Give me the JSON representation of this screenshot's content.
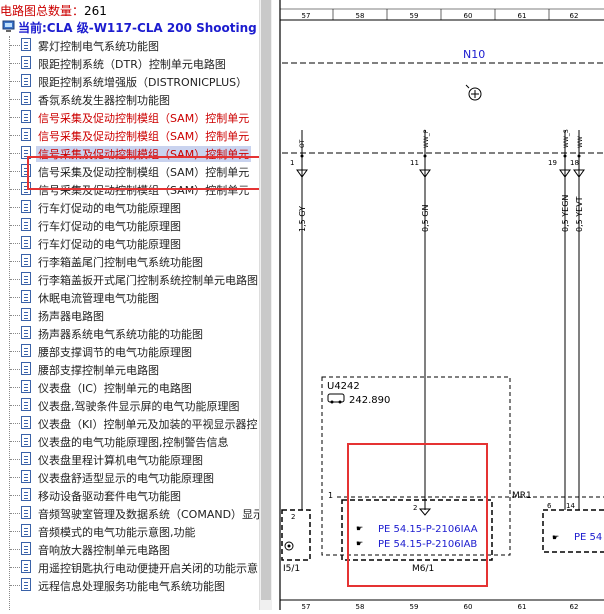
{
  "header": {
    "count_label": "电路图总数量：",
    "count_value": "261"
  },
  "tree": {
    "root_label": "当前:CLA 级-W117-CLA 200 Shooting B",
    "items": [
      {
        "label": "雾灯控制电气系统功能图",
        "style": "normal"
      },
      {
        "label": "限距控制系统（DTR）控制单元电路图",
        "style": "normal"
      },
      {
        "label": "限距控制系统增强版（DISTRONICPLUS）",
        "style": "normal"
      },
      {
        "label": "香氛系统发生器控制功能图",
        "style": "normal"
      },
      {
        "label": "信号采集及促动控制模组（SAM）控制单元",
        "style": "red"
      },
      {
        "label": "信号采集及促动控制模组（SAM）控制单元",
        "style": "red"
      },
      {
        "label": "信号采集及促动控制模组（SAM）控制单元",
        "style": "selected"
      },
      {
        "label": "信号采集及促动控制模组（SAM）控制单元",
        "style": "normal"
      },
      {
        "label": "信号采集及促动控制模组（SAM）控制单元",
        "style": "normal"
      },
      {
        "label": "行车灯促动的电气功能原理图",
        "style": "normal"
      },
      {
        "label": "行车灯促动的电气功能原理图",
        "style": "normal"
      },
      {
        "label": "行车灯促动的电气功能原理图",
        "style": "normal"
      },
      {
        "label": "行李箱盖尾门控制电气系统功能图",
        "style": "normal"
      },
      {
        "label": "行李箱盖扳开式尾门控制系统控制单元电路图",
        "style": "normal"
      },
      {
        "label": "休眠电流管理电气功能图",
        "style": "normal"
      },
      {
        "label": "扬声器电路图",
        "style": "normal"
      },
      {
        "label": "扬声器系统电气系统功能的功能图",
        "style": "normal"
      },
      {
        "label": "腰部支撑调节的电气功能原理图",
        "style": "normal"
      },
      {
        "label": "腰部支撑控制单元电路图",
        "style": "normal"
      },
      {
        "label": "仪表盘（IC）控制单元的电路图",
        "style": "normal"
      },
      {
        "label": "仪表盘,驾驶条件显示屏的电气功能原理图",
        "style": "normal"
      },
      {
        "label": "仪表盘（KI）控制单元及加装的平视显示器控",
        "style": "normal"
      },
      {
        "label": "仪表盘的电气功能原理图,控制警告信息",
        "style": "normal"
      },
      {
        "label": "仪表盘里程计算机电气功能原理图",
        "style": "normal"
      },
      {
        "label": "仪表盘舒适型显示的电气功能原理图",
        "style": "normal"
      },
      {
        "label": "移动设备驱动套件电气功能图",
        "style": "normal"
      },
      {
        "label": "音频驾驶室管理及数据系统（COMAND）显示",
        "style": "normal"
      },
      {
        "label": "音频模式的电气功能示意图,功能",
        "style": "normal"
      },
      {
        "label": "音响放大器控制单元电路图",
        "style": "normal"
      },
      {
        "label": "用遥控钥匙执行电动便捷开启关闭的功能示意",
        "style": "normal"
      },
      {
        "label": "远程信息处理服务功能电气系统功能图",
        "style": "normal"
      }
    ]
  },
  "diagram": {
    "col_numbers": [
      "57",
      "58",
      "59",
      "60",
      "61",
      "62"
    ],
    "bottom_col_numbers": [
      "57",
      "58",
      "59",
      "60",
      "61",
      "62"
    ],
    "module_top": "N10",
    "pins": [
      "1",
      "11",
      "19",
      "18"
    ],
    "signal_tags": [
      "OT",
      "WW_P",
      "WW_S",
      "WW"
    ],
    "wire_labels": [
      "1,5 GY",
      "0,5 GN",
      "0,5 YEGN",
      "0,5 YEVT"
    ],
    "ecu_name": "U4242",
    "ecu_value": "242.890",
    "connector_pin_label": "1",
    "connector_pin_2": "2",
    "mr_label": "MR1",
    "pe_refs": [
      "PE 54.15-P-2106IAA",
      "PE 54.15-P-2106IAB"
    ],
    "pe_ref_right": "PE 54",
    "connector_name": "M6/1",
    "left_component": "I5/1",
    "left_pin": "2",
    "right_pins": [
      "6",
      "14"
    ],
    "accent": "#1c1ccf",
    "highlight_color": "#e53333"
  }
}
